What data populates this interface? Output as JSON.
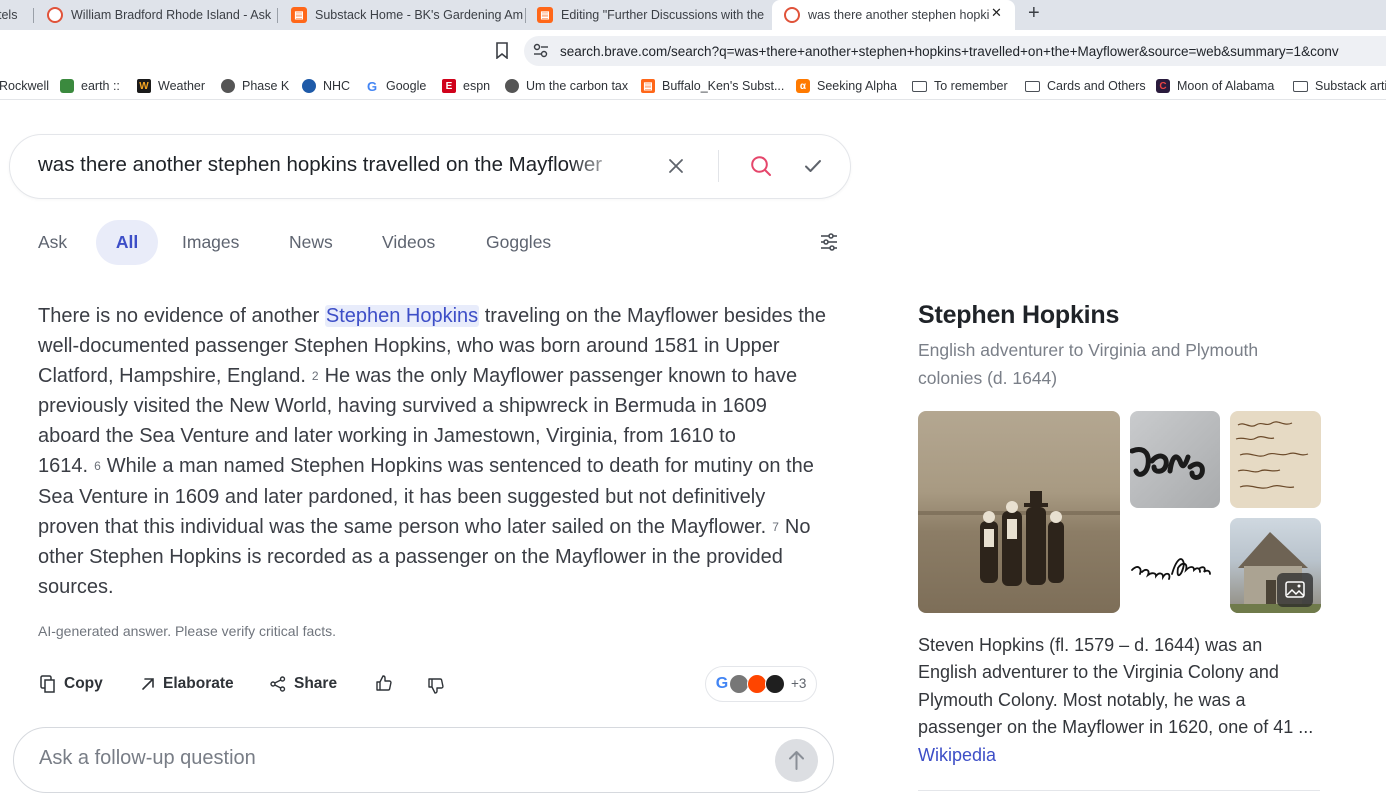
{
  "browser": {
    "tabs": [
      {
        "title": "tels",
        "favicon": "partial"
      },
      {
        "title": "William Bradford Rhode Island - Ask",
        "favicon": "brave-icon"
      },
      {
        "title": "Substack Home - BK's Gardening Am",
        "favicon": "substack-icon"
      },
      {
        "title": "Editing \"Further Discussions with the",
        "favicon": "substack-icon"
      },
      {
        "title": "was there another stephen hopki",
        "favicon": "brave-icon"
      }
    ],
    "close_glyph": "✕",
    "new_tab_glyph": "+",
    "url": "search.brave.com/search?q=was+there+another+stephen+hopkins+travelled+on+the+Mayflower&source=web&summary=1&conv",
    "bookmarks": [
      {
        "label": "Rockwell",
        "icon": "none"
      },
      {
        "label": "earth ::",
        "icon": "earth-icon"
      },
      {
        "label": "Weather",
        "icon": "weather-icon"
      },
      {
        "label": "Phase K",
        "icon": "globe-icon"
      },
      {
        "label": "NHC",
        "icon": "nhc-icon"
      },
      {
        "label": "Google",
        "icon": "google-icon"
      },
      {
        "label": "espn",
        "icon": "espn-icon"
      },
      {
        "label": "Um the carbon tax",
        "icon": "globe-icon"
      },
      {
        "label": "Buffalo_Ken's Subst...",
        "icon": "substack-icon"
      },
      {
        "label": "Seeking Alpha",
        "icon": "seeking-alpha-icon"
      },
      {
        "label": "To remember",
        "icon": "folder-icon"
      },
      {
        "label": "Cards and Others",
        "icon": "folder-icon"
      },
      {
        "label": "Moon of Alabama",
        "icon": "moon-icon"
      },
      {
        "label": "Substack artic",
        "icon": "folder-icon"
      }
    ]
  },
  "search": {
    "query": "was there another stephen hopkins travelled on the Mayflower",
    "tabs": [
      "Ask",
      "All",
      "Images",
      "News",
      "Videos",
      "Goggles"
    ],
    "active_tab": "All"
  },
  "answer": {
    "segments": {
      "p1": "There is no evidence of another ",
      "highlight": "Stephen Hopkins",
      "p2": " traveling on the Mayflower besides the well-documented passenger Stephen Hopkins, who was born around 1581 in Upper Clatford, Hampshire, England.",
      "c1": "2",
      "p3": "He was the only Mayflower passenger known to have previously visited the New World, having survived a shipwreck in Bermuda in 1609 aboard the Sea Venture and later working in Jamestown, Virginia, from 1610 to 1614.",
      "c2": "6",
      "p4": "While a man named Stephen Hopkins was sentenced to death for mutiny on the Sea Venture in 1609 and later pardoned, it has been suggested but not definitively proven that this individual was the same person who later sailed on the Mayflower.",
      "c3": "7",
      "p5": "No other Stephen Hopkins is recorded as a passenger on the Mayflower in the provided sources."
    },
    "disclaimer": "AI-generated answer. Please verify critical facts.",
    "actions": {
      "copy": "Copy",
      "elaborate": "Elaborate",
      "share": "Share"
    },
    "sources_more": "+3"
  },
  "followup": {
    "placeholder": "Ask a follow-up question"
  },
  "knowledge_panel": {
    "title": "Stephen Hopkins",
    "subtitle": "English adventurer to Virginia and Plymouth colonies (d. 1644)",
    "description": "Steven Hopkins (fl. 1579 – d. 1644) was an English adventurer to the Virginia Colony and Plymouth Colony. Most notably, he was a passenger on the Mayflower in 1620, one of 41 ...",
    "link": "Wikipedia"
  },
  "colors": {
    "accent": "#3d4ec7",
    "tab_bar": "#dfe3ea",
    "search_icon": "#e5466b",
    "substack": "#ff6719"
  }
}
